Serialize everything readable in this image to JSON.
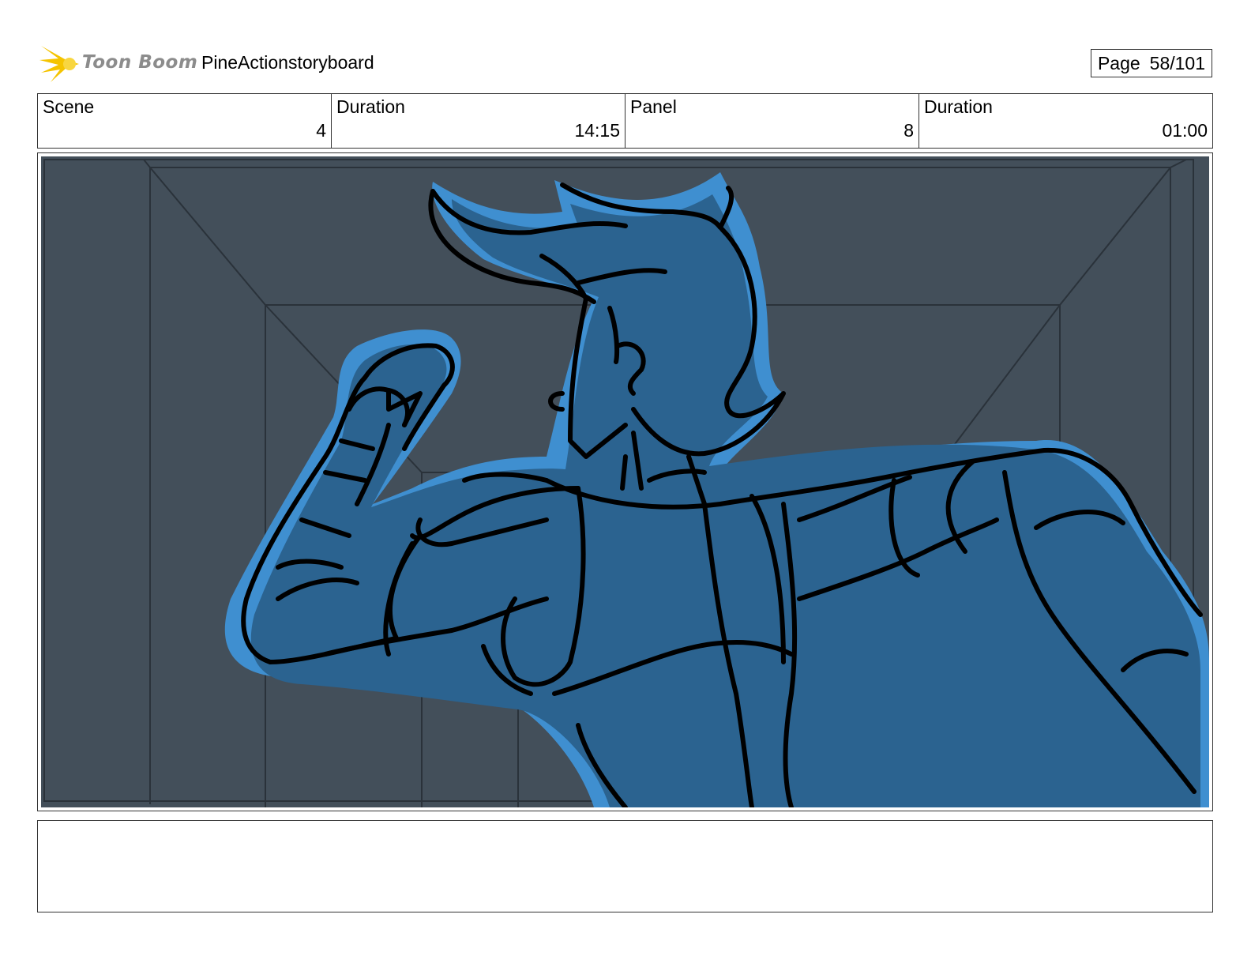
{
  "header": {
    "logo": {
      "brand_text": "Toon Boom",
      "icon": "sunburst-logo-icon",
      "icon_color": "#f5c400",
      "text_color": "#8c8c8c"
    },
    "project_title": "PineActionstoryboard",
    "page": {
      "label": "Page",
      "value": "58/101"
    }
  },
  "info": {
    "scene_label": "Scene",
    "scene_value": "4",
    "scene_duration_label": "Duration",
    "scene_duration_value": "14:15",
    "panel_label": "Panel",
    "panel_value": "8",
    "panel_duration_label": "Duration",
    "panel_duration_value": "01:00"
  },
  "panel": {
    "image": "storyboard-sketch-character-flexing-arm-in-corridor",
    "colors": {
      "background": "#434f5a",
      "perspective_lines": "#2a323a",
      "character_glow": "#3f8fd0",
      "character_fill": "#2b6390",
      "ink": "#000000"
    }
  },
  "notes": {
    "text": ""
  }
}
